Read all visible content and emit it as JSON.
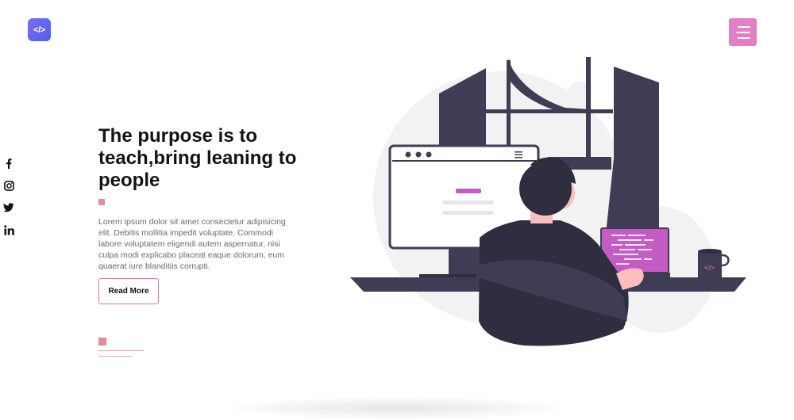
{
  "header": {
    "logo_icon": "code-icon",
    "logo_glyph": "</>",
    "menu_icon": "hamburger-icon"
  },
  "social": [
    {
      "name": "facebook",
      "glyph": "f"
    },
    {
      "name": "instagram",
      "glyph": "instagram"
    },
    {
      "name": "twitter",
      "glyph": "twitter"
    },
    {
      "name": "linkedin",
      "glyph": "in"
    }
  ],
  "hero": {
    "headline": "The purpose is to teach,bring leaning to people",
    "body": "Lorem ipsum dolor sit amet consectetur adipisicing elit. Debitis mollitia impedit voluptate. Commodi labore voluptatem eligendi autem aspernatur, nisi culpa modi explicabo placeat eaque dolorum, eum quaerat iure blanditiis corrupti.",
    "cta_label": "Read More",
    "illustration": "developer-at-desk-illustration",
    "mug_glyph": "</>"
  },
  "colors": {
    "accent_pink": "#e27fc7",
    "marker_pink": "#e38a99",
    "logo_purple": "#6b66f4",
    "illustration_dark": "#3f3d56",
    "laptop_screen": "#c45cc4"
  }
}
